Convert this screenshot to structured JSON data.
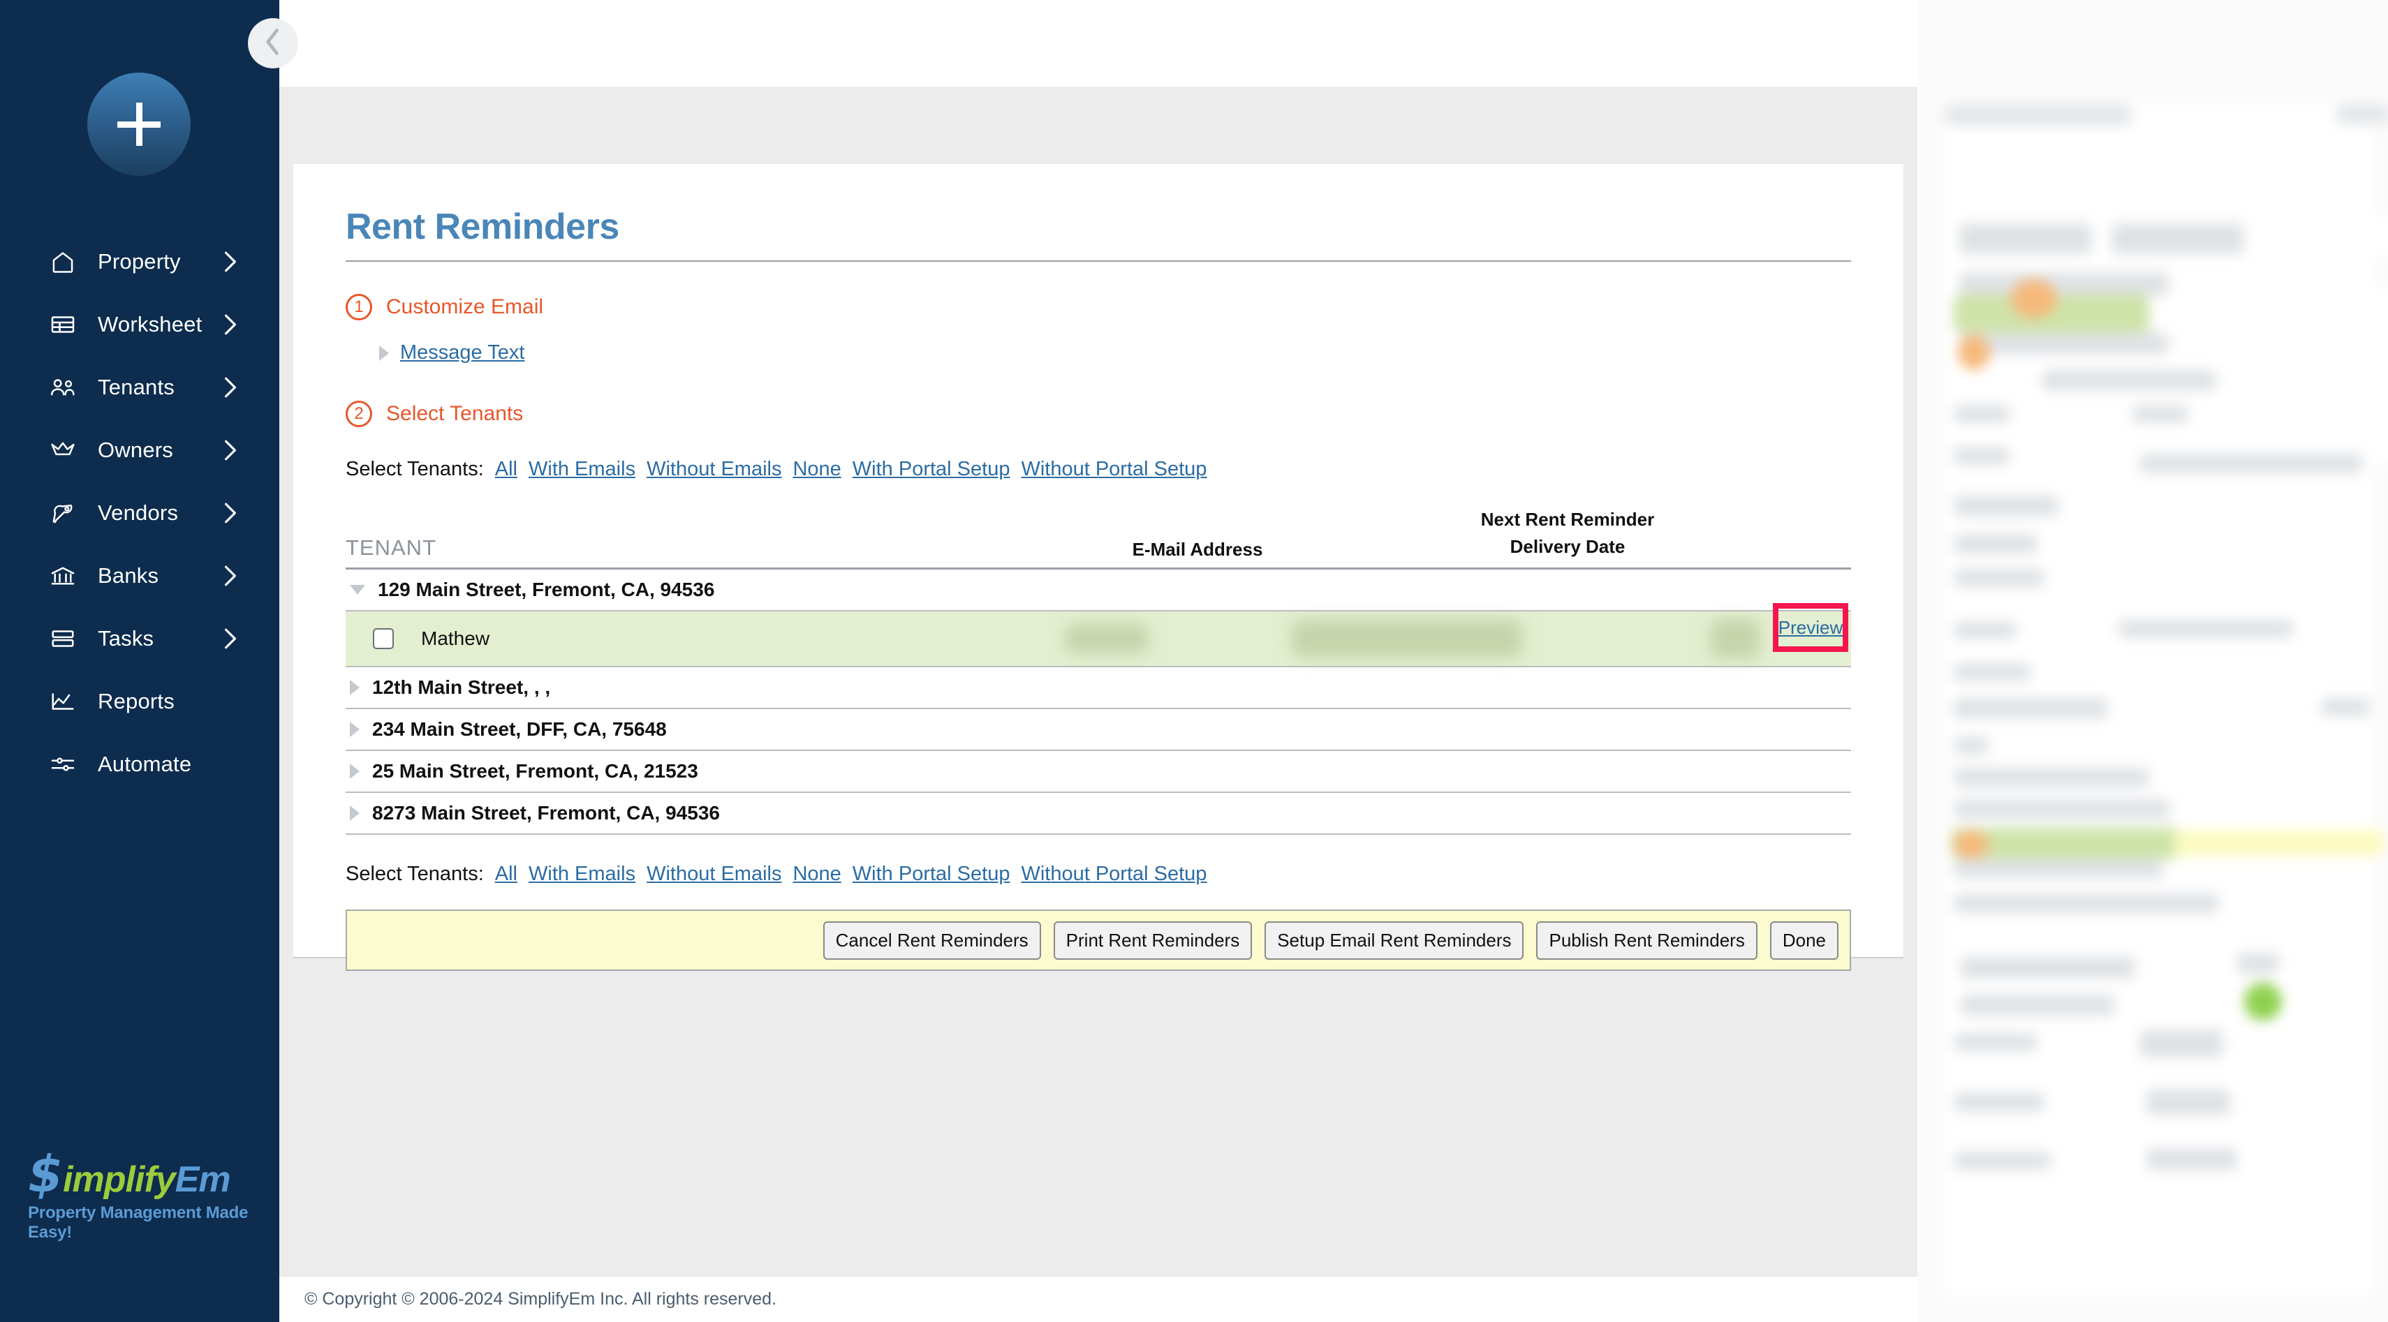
{
  "sidebar": {
    "add_button_icon": "plus-icon",
    "items": [
      {
        "label": "Property",
        "icon": "home-icon",
        "chevron": true
      },
      {
        "label": "Worksheet",
        "icon": "table-icon",
        "chevron": true
      },
      {
        "label": "Tenants",
        "icon": "users-icon",
        "chevron": true
      },
      {
        "label": "Owners",
        "icon": "crown-icon",
        "chevron": true
      },
      {
        "label": "Vendors",
        "icon": "wrench-icon",
        "chevron": true
      },
      {
        "label": "Banks",
        "icon": "bank-icon",
        "chevron": true
      },
      {
        "label": "Tasks",
        "icon": "tasks-icon",
        "chevron": true
      },
      {
        "label": "Reports",
        "icon": "chart-icon",
        "chevron": false
      },
      {
        "label": "Automate",
        "icon": "sliders-icon",
        "chevron": false
      }
    ],
    "brand": {
      "dollar": "$",
      "word_primary": "implify",
      "word_secondary": "Em",
      "tagline": "Property Management Made Easy!"
    }
  },
  "topbar": {
    "collapse_icon": "chevron-left-icon",
    "user_email": "",
    "avatar_label": ""
  },
  "main": {
    "title": "Rent Reminders",
    "steps": [
      {
        "number": "1",
        "label": "Customize Email"
      },
      {
        "number": "2",
        "label": "Select Tenants"
      }
    ],
    "message_text_link": "Message Text",
    "select_tenants": {
      "label": "Select Tenants:",
      "links": [
        "All",
        "With Emails",
        "Without Emails",
        "None",
        "With Portal Setup",
        "Without Portal Setup"
      ]
    },
    "table": {
      "headers": {
        "tenant": "TENANT",
        "email": "E-Mail Address",
        "date_line1": "Next Rent Reminder",
        "date_line2": "Delivery Date"
      },
      "properties": [
        {
          "address": "129 Main Street, Fremont, CA, 94536",
          "expanded": true,
          "tenants": [
            {
              "name": "Mathew",
              "checked": false,
              "preview_label": "Preview",
              "highlighted": true
            }
          ]
        },
        {
          "address": "12th Main Street, , ,",
          "expanded": false,
          "tenants": []
        },
        {
          "address": "234 Main Street, DFF, CA, 75648",
          "expanded": false,
          "tenants": []
        },
        {
          "address": "25 Main Street, Fremont, CA, 21523",
          "expanded": false,
          "tenants": []
        },
        {
          "address": "8273 Main Street, Fremont, CA, 94536",
          "expanded": false,
          "tenants": []
        }
      ]
    },
    "buttons": [
      "Cancel Rent Reminders",
      "Print Rent Reminders",
      "Setup Email Rent Reminders",
      "Publish Rent Reminders",
      "Done"
    ]
  },
  "footer": {
    "copyright": "© Copyright © 2006-2024 SimplifyEm Inc. All rights reserved."
  },
  "colors": {
    "sidebar_bg": "#0d2c4e",
    "title_blue": "#4a86b8",
    "step_orange": "#e8562a",
    "link_blue": "#2b6ca3",
    "row_green": "#e3efd0",
    "button_bar_yellow": "#fbfbcf",
    "highlight_pink": "#f4174f",
    "brand_green": "#9ccb3b",
    "brand_blue": "#5b9bd5"
  }
}
